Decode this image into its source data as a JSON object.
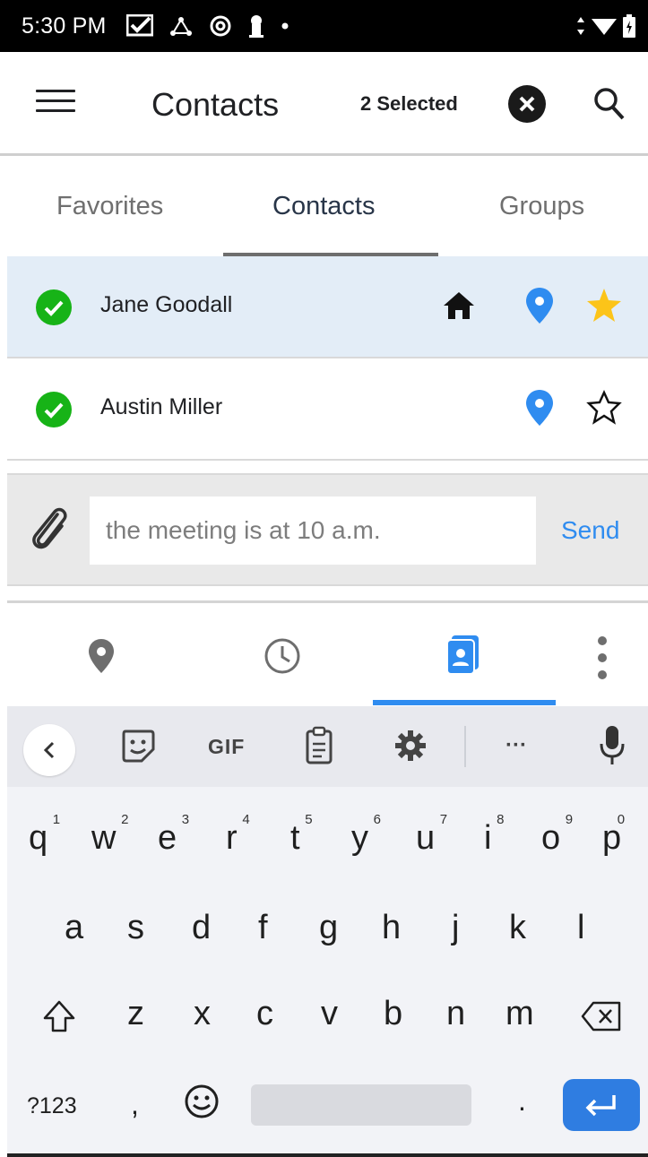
{
  "status_bar": {
    "time": "5:30 PM"
  },
  "app_bar": {
    "title": "Contacts",
    "selected_count": "2 Selected"
  },
  "tabs": [
    {
      "label": "Favorites",
      "active": false
    },
    {
      "label": "Contacts",
      "active": true
    },
    {
      "label": "Groups",
      "active": false
    }
  ],
  "contacts": [
    {
      "name": "Jane Goodall",
      "selected": true,
      "has_home": true,
      "has_location": true,
      "favorite": true
    },
    {
      "name": "Austin Miller",
      "selected": true,
      "has_home": false,
      "has_location": true,
      "favorite": false
    }
  ],
  "composer": {
    "message": "the meeting is at 10 a.m.",
    "send_label": "Send"
  },
  "bottom_nav": {
    "items": [
      "location-icon",
      "clock-icon",
      "contacts-card-icon",
      "more-vert-icon"
    ],
    "active_index": 2
  },
  "keyboard": {
    "toolbar": {
      "gif_label": "GIF",
      "more_label": "···"
    },
    "row1": [
      {
        "key": "q",
        "hint": "1"
      },
      {
        "key": "w",
        "hint": "2"
      },
      {
        "key": "e",
        "hint": "3"
      },
      {
        "key": "r",
        "hint": "4"
      },
      {
        "key": "t",
        "hint": "5"
      },
      {
        "key": "y",
        "hint": "6"
      },
      {
        "key": "u",
        "hint": "7"
      },
      {
        "key": "i",
        "hint": "8"
      },
      {
        "key": "o",
        "hint": "9"
      },
      {
        "key": "p",
        "hint": "0"
      }
    ],
    "row2": [
      "a",
      "s",
      "d",
      "f",
      "g",
      "h",
      "j",
      "k",
      "l"
    ],
    "row3": [
      "z",
      "x",
      "c",
      "v",
      "b",
      "n",
      "m"
    ],
    "symbols_label": "?123",
    "comma_label": ",",
    "period_label": "."
  },
  "colors": {
    "accent": "#2f8cf0",
    "selected_row": "#e3edf7",
    "check_green": "#17b317",
    "star_yellow": "#fcc419",
    "pin_blue": "#2f8cf0",
    "enter_blue": "#2f7de1"
  }
}
